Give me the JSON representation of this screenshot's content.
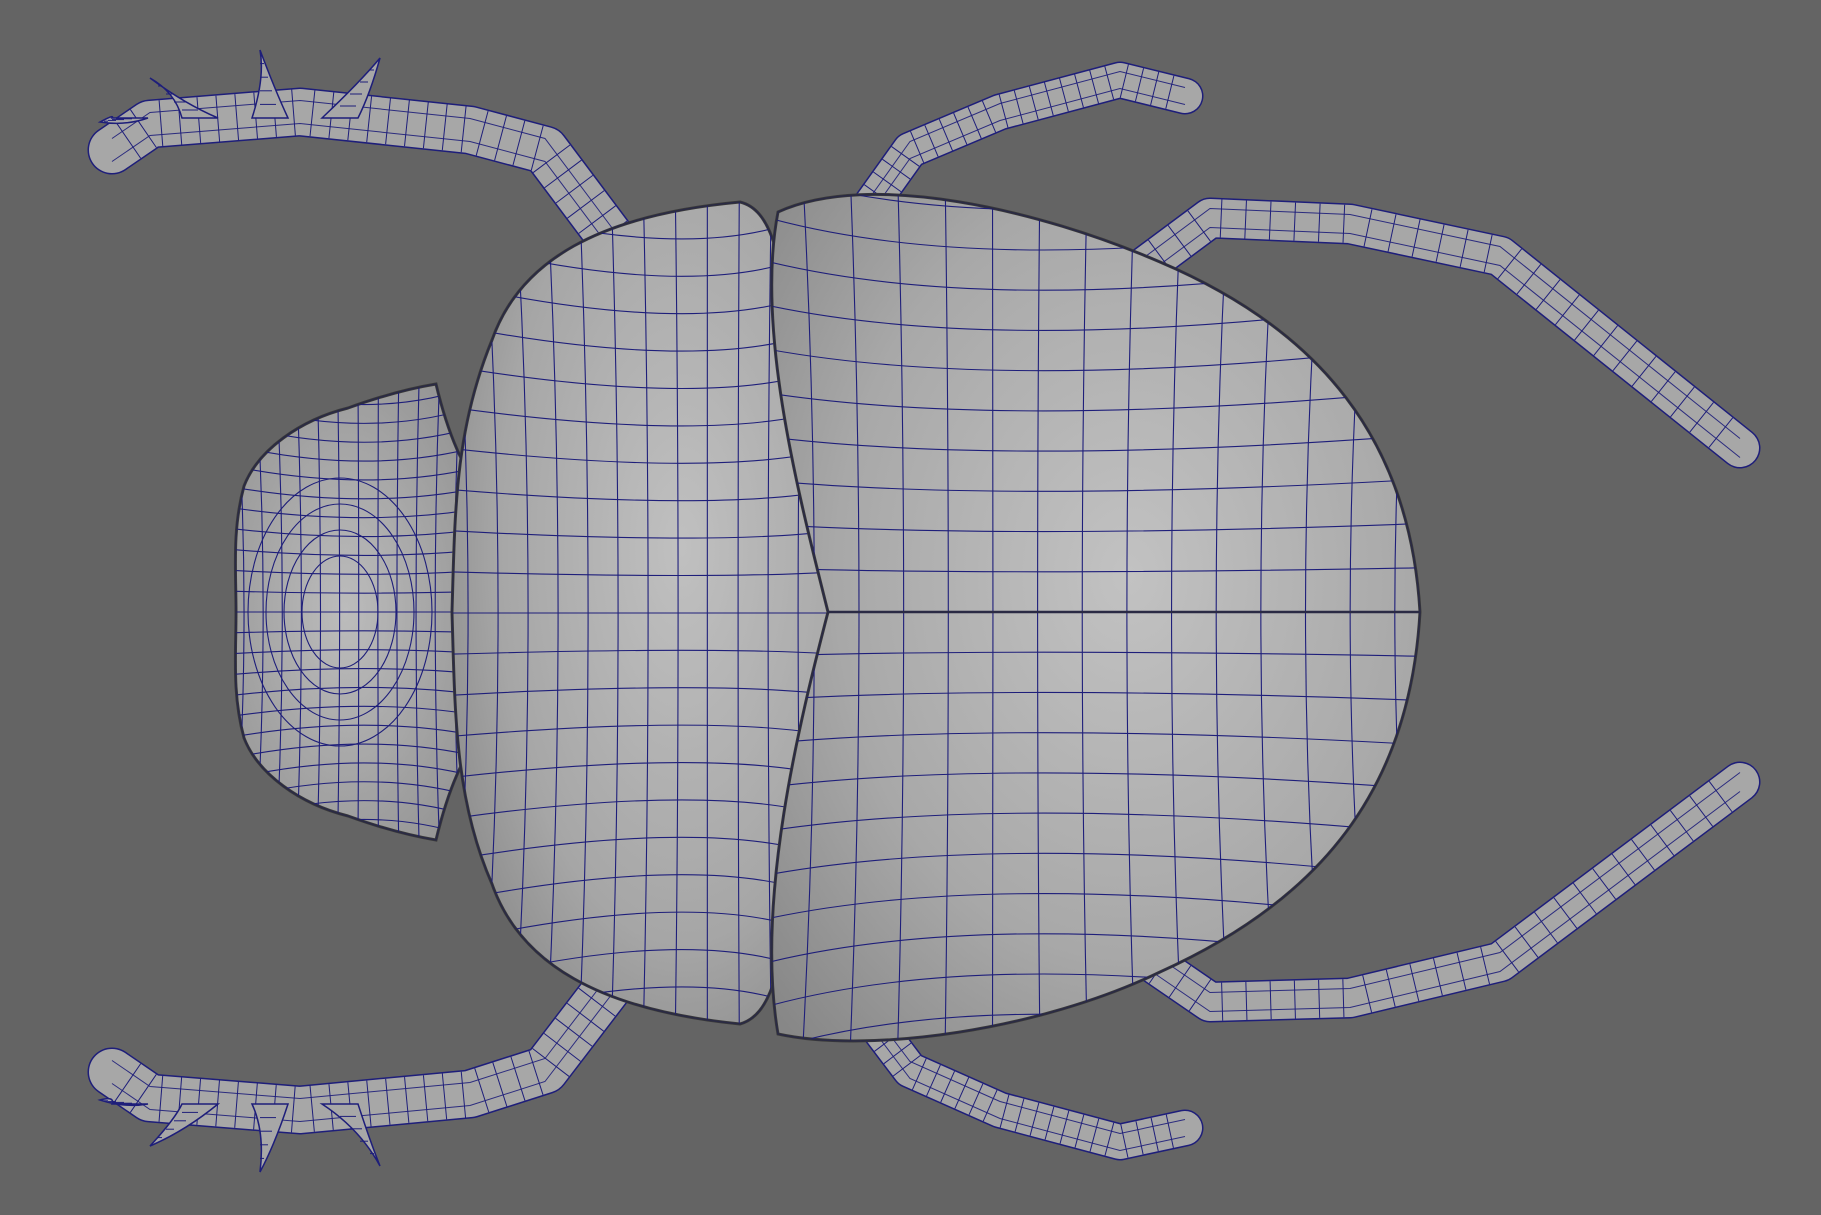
{
  "viewport": {
    "background": "#646464",
    "shading": "smooth-shaded-wireframe-on-shaded"
  },
  "model": {
    "subject": "scarab-beetle",
    "body_fill": "#a7a7a7",
    "body_light": "#c3c3c3",
    "body_dark": "#7e7e7e",
    "wire_color": "#1e1e7a"
  }
}
